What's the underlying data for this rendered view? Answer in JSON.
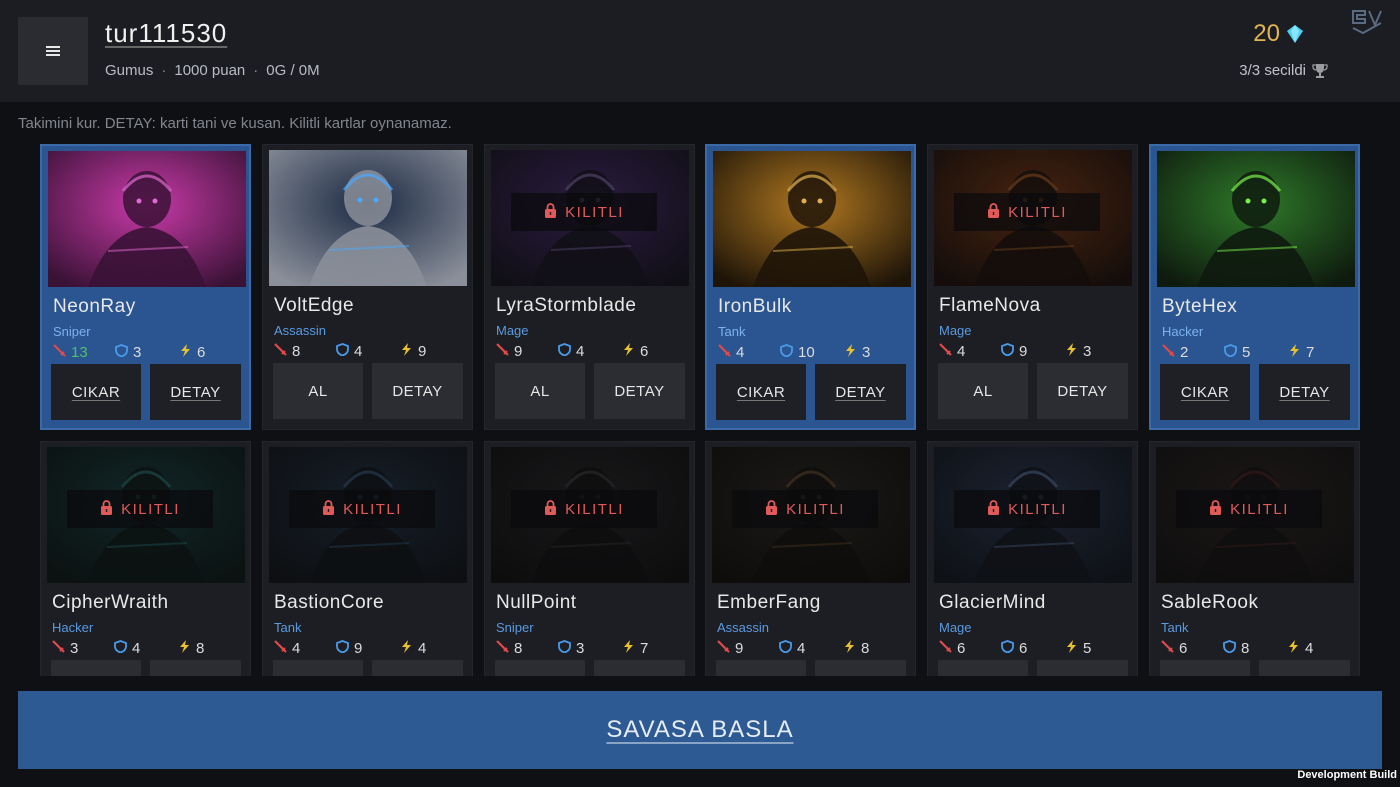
{
  "header": {
    "username": "tur111530",
    "rank": "Gumus",
    "points": "1000 puan",
    "record": "0G / 0M",
    "currency_amount": "20",
    "selected_count": "3/3 secildi"
  },
  "hint": "Takimini kur. DETAY: karti tani ve kusan. Kilitli kartlar oynanamaz.",
  "lock_label": "KILITLI",
  "cards": [
    {
      "name": "NeonRay",
      "role": "Sniper",
      "atk": "13",
      "def": "3",
      "spd": "6",
      "selected": true,
      "locked": false,
      "primary": "CIKAR",
      "detail": "DETAY",
      "palette": [
        "#3a1236",
        "#c93aa8",
        "#e06ad0"
      ]
    },
    {
      "name": "VoltEdge",
      "role": "Assassin",
      "atk": "8",
      "def": "4",
      "spd": "9",
      "selected": false,
      "locked": false,
      "primary": "AL",
      "detail": "DETAY",
      "palette": [
        "#8a8f99",
        "#1c2a44",
        "#4aa8ff"
      ]
    },
    {
      "name": "LyraStormblade",
      "role": "Mage",
      "atk": "9",
      "def": "4",
      "spd": "6",
      "selected": false,
      "locked": true,
      "primary": "AL",
      "detail": "DETAY",
      "palette": [
        "#120d1e",
        "#4a2a7a",
        "#9a7ad0"
      ]
    },
    {
      "name": "IronBulk",
      "role": "Tank",
      "atk": "4",
      "def": "10",
      "spd": "3",
      "selected": true,
      "locked": false,
      "primary": "CIKAR",
      "detail": "DETAY",
      "palette": [
        "#1e1408",
        "#b07820",
        "#e0b050"
      ]
    },
    {
      "name": "FlameNova",
      "role": "Mage",
      "atk": "4",
      "def": "9",
      "spd": "3",
      "selected": false,
      "locked": true,
      "primary": "AL",
      "detail": "DETAY",
      "palette": [
        "#1a0a04",
        "#8a3a10",
        "#d0702a"
      ]
    },
    {
      "name": "ByteHex",
      "role": "Hacker",
      "atk": "2",
      "def": "5",
      "spd": "7",
      "selected": true,
      "locked": false,
      "primary": "CIKAR",
      "detail": "DETAY",
      "palette": [
        "#0e1a0e",
        "#2f7a2a",
        "#7af04a"
      ]
    },
    {
      "name": "CipherWraith",
      "role": "Hacker",
      "atk": "3",
      "def": "4",
      "spd": "8",
      "selected": false,
      "locked": true,
      "primary": "",
      "detail": "",
      "palette": [
        "#061414",
        "#124040",
        "#2a8a8a"
      ]
    },
    {
      "name": "BastionCore",
      "role": "Tank",
      "atk": "4",
      "def": "9",
      "spd": "4",
      "selected": false,
      "locked": true,
      "primary": "",
      "detail": "",
      "palette": [
        "#0a0e14",
        "#1e3048",
        "#3a6a9a"
      ]
    },
    {
      "name": "NullPoint",
      "role": "Sniper",
      "atk": "8",
      "def": "3",
      "spd": "7",
      "selected": false,
      "locked": true,
      "primary": "",
      "detail": "",
      "palette": [
        "#0a0a0c",
        "#222226",
        "#444448"
      ]
    },
    {
      "name": "EmberFang",
      "role": "Assassin",
      "atk": "9",
      "def": "4",
      "spd": "8",
      "selected": false,
      "locked": true,
      "primary": "",
      "detail": "",
      "palette": [
        "#0c0a08",
        "#2a241e",
        "#7a5a30"
      ]
    },
    {
      "name": "GlacierMind",
      "role": "Mage",
      "atk": "6",
      "def": "6",
      "spd": "5",
      "selected": false,
      "locked": true,
      "primary": "",
      "detail": "",
      "palette": [
        "#0c121c",
        "#2a3a5a",
        "#6a8ac0"
      ]
    },
    {
      "name": "SableRook",
      "role": "Tank",
      "atk": "6",
      "def": "8",
      "spd": "4",
      "selected": false,
      "locked": true,
      "primary": "",
      "detail": "",
      "palette": [
        "#0e0c0c",
        "#2a1e1e",
        "#5a2424"
      ]
    }
  ],
  "start_button": "SAVASA BASLA",
  "dev_build": "Development Build",
  "colors": {
    "accent_blue": "#2d5a93",
    "gold": "#e1b550",
    "gem": "#4fd0f0",
    "lock_red": "#e05a5a",
    "role_blue": "#5a9ae0"
  }
}
